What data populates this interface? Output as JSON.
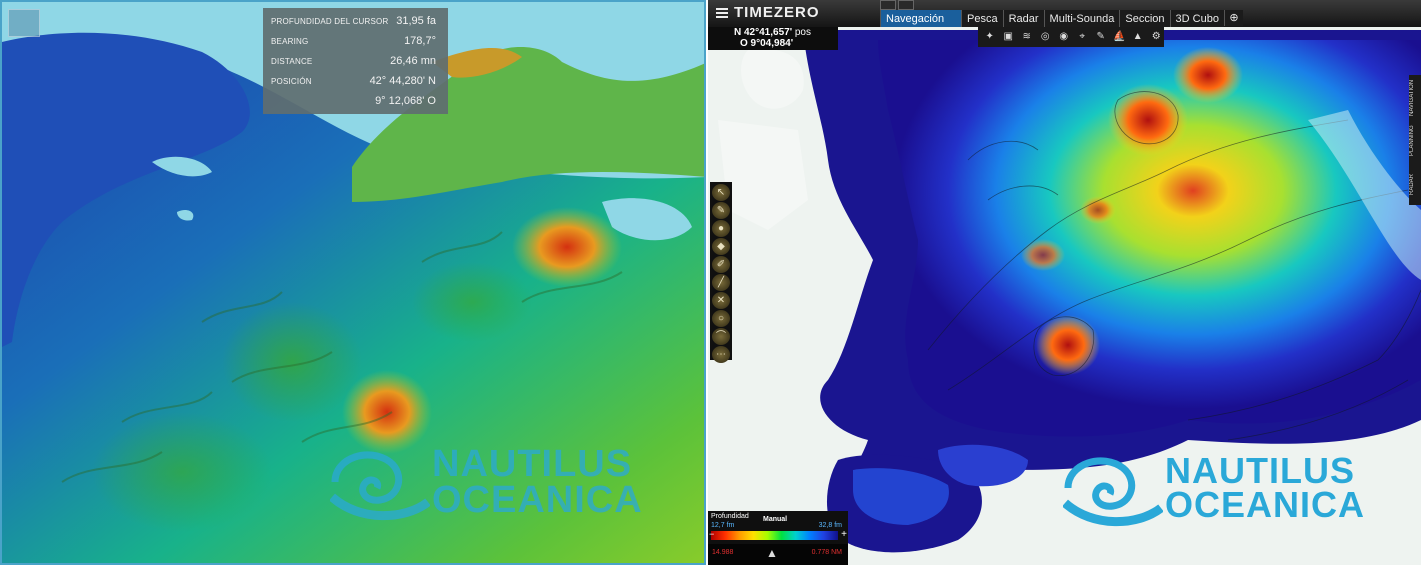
{
  "left_panel": {
    "cursor_info": {
      "depth_label": "PROFUNDIDAD DEL CURSOR",
      "depth_value": "31,95 fa",
      "bearing_label": "BEARING",
      "bearing_value": "178,7°",
      "distance_label": "DISTANCE",
      "distance_value": "26,46 mn",
      "position_label": "POSICIÓN",
      "lat_value": "42° 44,280' N",
      "lon_value": "9° 12,068' O"
    },
    "pin_icon": "pin-icon"
  },
  "right_panel": {
    "app_title": "TIMEZERO",
    "tabs": [
      {
        "label": "Navegación",
        "active": true
      },
      {
        "label": "Pesca",
        "active": false
      },
      {
        "label": "Radar",
        "active": false
      },
      {
        "label": "Multi-Sounda",
        "active": false
      },
      {
        "label": "Seccion",
        "active": false
      },
      {
        "label": "3D Cubo",
        "active": false
      }
    ],
    "position": {
      "lat": "N 42°41,657'",
      "pos_suffix": "pos",
      "lon": "O 9°04,984'"
    },
    "side_tabs": [
      "NAVIGATION",
      "PLANNING",
      "RADAR"
    ],
    "depth_legend": {
      "title": "Profundidad",
      "mode": "Manual",
      "min": "12,7 fm",
      "max": "32,8 fm",
      "left_value": "14.988",
      "right_value": "0.778 NM"
    }
  },
  "logo": {
    "line1": "NAUTILUS",
    "line2": "OCEANICA"
  },
  "colors": {
    "accent_blue": "#1a5f9c",
    "logo_blue": "#2aa8d8",
    "panel_border": "#4aa3c9"
  }
}
